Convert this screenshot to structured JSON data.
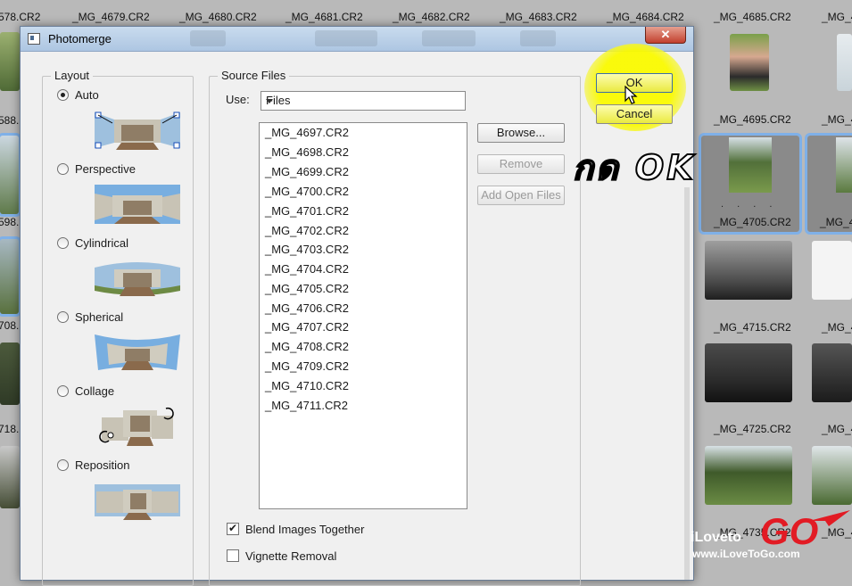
{
  "background": {
    "top_labels": [
      "578.CR2",
      "_MG_4679.CR2",
      "_MG_4680.CR2",
      "_MG_4681.CR2",
      "_MG_4682.CR2",
      "_MG_4683.CR2",
      "_MG_4684.CR2",
      "_MG_4685.CR2",
      "_MG_4"
    ],
    "left_labels": [
      "588.",
      "598.",
      "708.",
      "718."
    ],
    "right_labels": {
      "row2": "_MG_4695.CR2",
      "row2b": "_MG_4",
      "row3": "_MG_4705.CR2",
      "row3b": "_MG_4",
      "row4": "_MG_4715.CR2",
      "row4b": "_MG_4",
      "row5": "_MG_4725.CR2",
      "row5b": "_MG_4",
      "row6": "_MG_4735.CR2",
      "row6b": "_MG_4"
    },
    "dots": ". . . ."
  },
  "dialog": {
    "title": "Photomerge",
    "close_label": "✕",
    "layout": {
      "legend": "Layout",
      "options": [
        {
          "label": "Auto",
          "selected": true
        },
        {
          "label": "Perspective",
          "selected": false
        },
        {
          "label": "Cylindrical",
          "selected": false
        },
        {
          "label": "Spherical",
          "selected": false
        },
        {
          "label": "Collage",
          "selected": false
        },
        {
          "label": "Reposition",
          "selected": false
        }
      ]
    },
    "source": {
      "legend": "Source Files",
      "use_label": "Use:",
      "use_value": "Files",
      "files": [
        "_MG_4697.CR2",
        "_MG_4698.CR2",
        "_MG_4699.CR2",
        "_MG_4700.CR2",
        "_MG_4701.CR2",
        "_MG_4702.CR2",
        "_MG_4703.CR2",
        "_MG_4704.CR2",
        "_MG_4705.CR2",
        "_MG_4706.CR2",
        "_MG_4707.CR2",
        "_MG_4708.CR2",
        "_MG_4709.CR2",
        "_MG_4710.CR2",
        "_MG_4711.CR2"
      ],
      "browse_label": "Browse...",
      "remove_label": "Remove",
      "add_open_label": "Add Open Files"
    },
    "ok_label": "OK",
    "cancel_label": "Cancel",
    "options": {
      "blend_label": "Blend Images Together",
      "blend_checked": true,
      "vignette_label": "Vignette Removal",
      "vignette_checked": false
    }
  },
  "annotation": {
    "text": "กด OK",
    "highlight_color": "#f6f600"
  },
  "watermark": {
    "brand_part1": "iLoveto",
    "brand_part2": "GO",
    "url": "www.iLoveToGo.com"
  }
}
